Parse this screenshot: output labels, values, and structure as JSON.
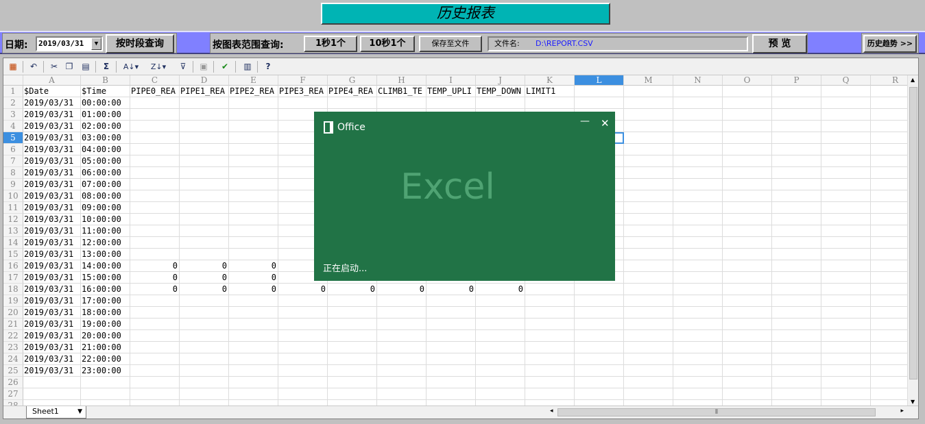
{
  "title": "历史报表",
  "controls": {
    "date_label": "日期:",
    "date_value": "2019/03/31",
    "query_by_period": "按时段查询",
    "query_by_range_label": "按图表范围查询:",
    "per_1s": "1秒1个",
    "per_10s": "10秒1个",
    "save_to_file": "保存至文件",
    "filename_label": "文件名:",
    "filename_value": "D:\\REPORT.CSV",
    "preview": "预 览",
    "history_trend": "历史趋势 >>"
  },
  "toolbar_icons": [
    "cut-icon",
    "copy-icon",
    "paste-icon",
    "sum-icon",
    "sort-asc-icon",
    "sort-desc-icon",
    "filter-icon",
    "insert-icon",
    "format-icon",
    "export-icon",
    "help-icon"
  ],
  "sheet": {
    "columns": [
      "A",
      "B",
      "C",
      "D",
      "E",
      "F",
      "G",
      "H",
      "I",
      "J",
      "K",
      "L",
      "M",
      "N",
      "O",
      "P",
      "Q",
      "R"
    ],
    "selected_column": "L",
    "selected_row": 5,
    "headers": [
      "$Date",
      "$Time",
      "PIPE0_REA",
      "PIPE1_REA",
      "PIPE2_REA",
      "PIPE3_REA",
      "PIPE4_REA",
      "CLIMB1_TE",
      "TEMP_UPLI",
      "TEMP_DOWN",
      "LIMIT1"
    ],
    "row_count": 28,
    "rows": [
      [
        "2019/03/31",
        "00:00:00"
      ],
      [
        "2019/03/31",
        "01:00:00"
      ],
      [
        "2019/03/31",
        "02:00:00"
      ],
      [
        "2019/03/31",
        "03:00:00"
      ],
      [
        "2019/03/31",
        "04:00:00"
      ],
      [
        "2019/03/31",
        "05:00:00"
      ],
      [
        "2019/03/31",
        "06:00:00"
      ],
      [
        "2019/03/31",
        "07:00:00"
      ],
      [
        "2019/03/31",
        "08:00:00"
      ],
      [
        "2019/03/31",
        "09:00:00"
      ],
      [
        "2019/03/31",
        "10:00:00"
      ],
      [
        "2019/03/31",
        "11:00:00"
      ],
      [
        "2019/03/31",
        "12:00:00"
      ],
      [
        "2019/03/31",
        "13:00:00"
      ],
      [
        "2019/03/31",
        "14:00:00",
        "0",
        "0",
        "0"
      ],
      [
        "2019/03/31",
        "15:00:00",
        "0",
        "0",
        "0"
      ],
      [
        "2019/03/31",
        "16:00:00",
        "0",
        "0",
        "0",
        "0",
        "0",
        "0",
        "0",
        "0"
      ],
      [
        "2019/03/31",
        "17:00:00"
      ],
      [
        "2019/03/31",
        "18:00:00"
      ],
      [
        "2019/03/31",
        "19:00:00"
      ],
      [
        "2019/03/31",
        "20:00:00"
      ],
      [
        "2019/03/31",
        "21:00:00"
      ],
      [
        "2019/03/31",
        "22:00:00"
      ],
      [
        "2019/03/31",
        "23:00:00"
      ]
    ],
    "tab_name": "Sheet1"
  },
  "splash": {
    "brand": "Office",
    "app_name": "Excel",
    "status": "正在启动..."
  }
}
